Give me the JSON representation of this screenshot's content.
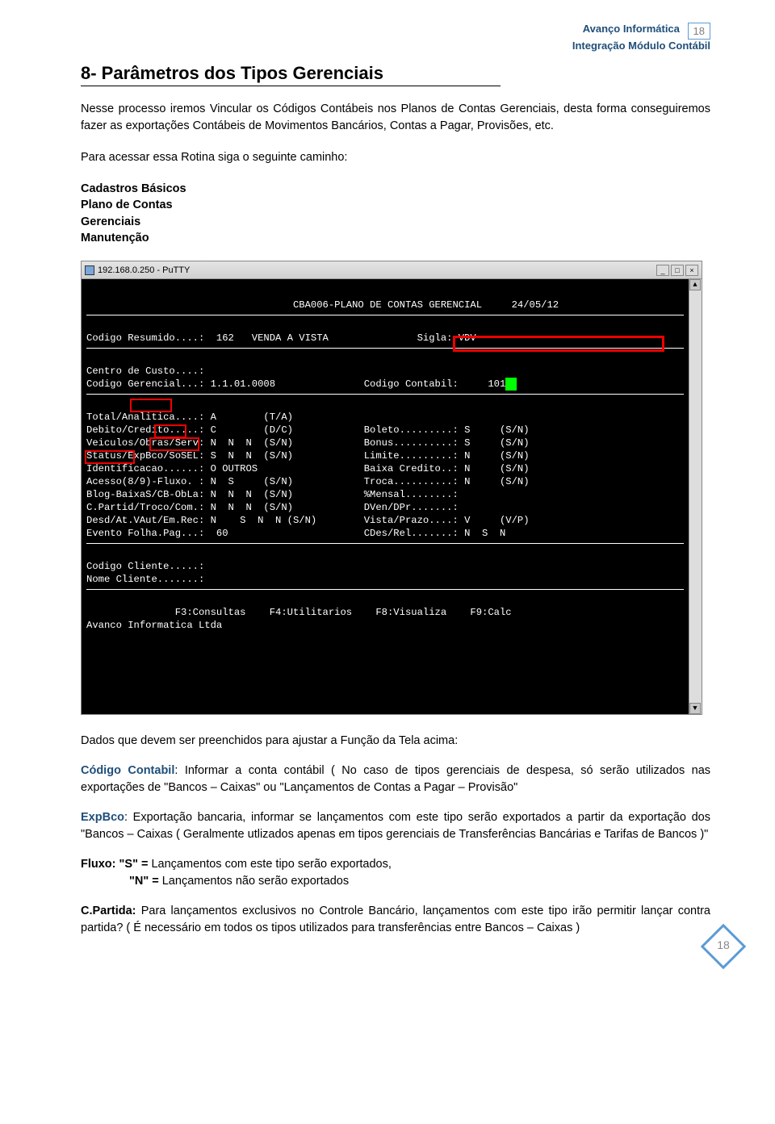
{
  "header": {
    "brand_line1": "Avanço Informática",
    "brand_line2": "Integração Módulo Contábil",
    "page_number_top": "18"
  },
  "section": {
    "title": "8- Parâmetros dos Tipos Gerenciais",
    "intro": "Nesse processo iremos Vincular os Códigos Contábeis nos Planos de Contas Gerenciais, desta forma conseguiremos fazer as exportações Contábeis de Movimentos Bancários, Contas a Pagar, Provisões, etc.",
    "access_line": "Para acessar essa Rotina siga o seguinte caminho:",
    "nav_path": [
      "Cadastros Básicos",
      "Plano de Contas",
      "Gerenciais",
      "Manutenção"
    ]
  },
  "terminal": {
    "title": "192.168.0.250 - PuTTY",
    "screen_title": "CBA006-PLANO DE CONTAS GERENCIAL",
    "date": "24/05/12",
    "row_codigo_resumido": "Codigo Resumido....:  162   VENDA A VISTA               Sigla: VDV",
    "row_centro_custo": "Centro de Custo....:",
    "row_cod_gerencial": "Codigo Gerencial...: 1.1.01.0008               Codigo Contabil:     101",
    "rows_left": [
      "Total/Analitica....: A        (T/A)",
      "Debito/Credito.....: C        (D/C)            Boleto.........: S     (S/N)",
      "Veiculos/Obras/Serv: N  N  N  (S/N)            Bonus..........: S     (S/N)",
      "Status/ExpBco/SoSEL: S  N  N  (S/N)            Limite.........: N     (S/N)",
      "Identificacao......: O OUTROS                  Baixa Credito..: N     (S/N)",
      "Acesso(8/9)-Fluxo. : N  S     (S/N)            Troca..........: N     (S/N)",
      "Blog-BaixaS/CB-ObLa: N  N  N  (S/N)            %Mensal........:",
      "C.Partid/Troco/Com.: N  N  N  (S/N)            DVen/DPr.......:",
      "Desd/At.VAut/Em.Rec: N    S  N  N (S/N)        Vista/Prazo....: V     (V/P)",
      "Evento Folha.Pag...:  60                       CDes/Rel.......: N  S  N"
    ],
    "row_cod_cliente": "Codigo Cliente.....:",
    "row_nome_cliente": "Nome Cliente.......:",
    "fkeys": "               F3:Consultas    F4:Utilitarios    F8:Visualiza    F9:Calc",
    "footer_co": "Avanco Informatica Ltda"
  },
  "post_text": {
    "line1": "Dados que devem ser preenchidos para ajustar a Função da Tela acima:",
    "p_codigo_lbl": "Código Contabil",
    "p_codigo": ": Informar a conta contábil ( No caso de tipos gerenciais de despesa, só serão utilizados  nas exportações de \"Bancos – Caixas\" ou \"Lançamentos de Contas a Pagar – Provisão\"",
    "p_expbco_lbl": "ExpBco",
    "p_expbco": ": Exportação bancaria, informar se lançamentos com este tipo serão exportados a partir  da exportação dos \"Bancos – Caixas ( Geralmente utlizados apenas em tipos gerenciais de  Transferências Bancárias e Tarifas de Bancos )\"",
    "p_fluxo_s_lbl": "Fluxo: \"S\" =",
    "p_fluxo_s": " Lançamentos com este tipo serão exportados,",
    "p_fluxo_n_lbl": "\"N\" =",
    "p_fluxo_n": " Lançamentos não serão exportados",
    "p_cpartida_lbl": "C.Partida:",
    "p_cpartida": " Para lançamentos exclusivos no Controle Bancário, lançamentos com este tipo irão permitir lançar contra partida? ( É necessário em todos os tipos utilizados para transferências entre Bancos – Caixas )"
  },
  "footer_page_number": "18"
}
